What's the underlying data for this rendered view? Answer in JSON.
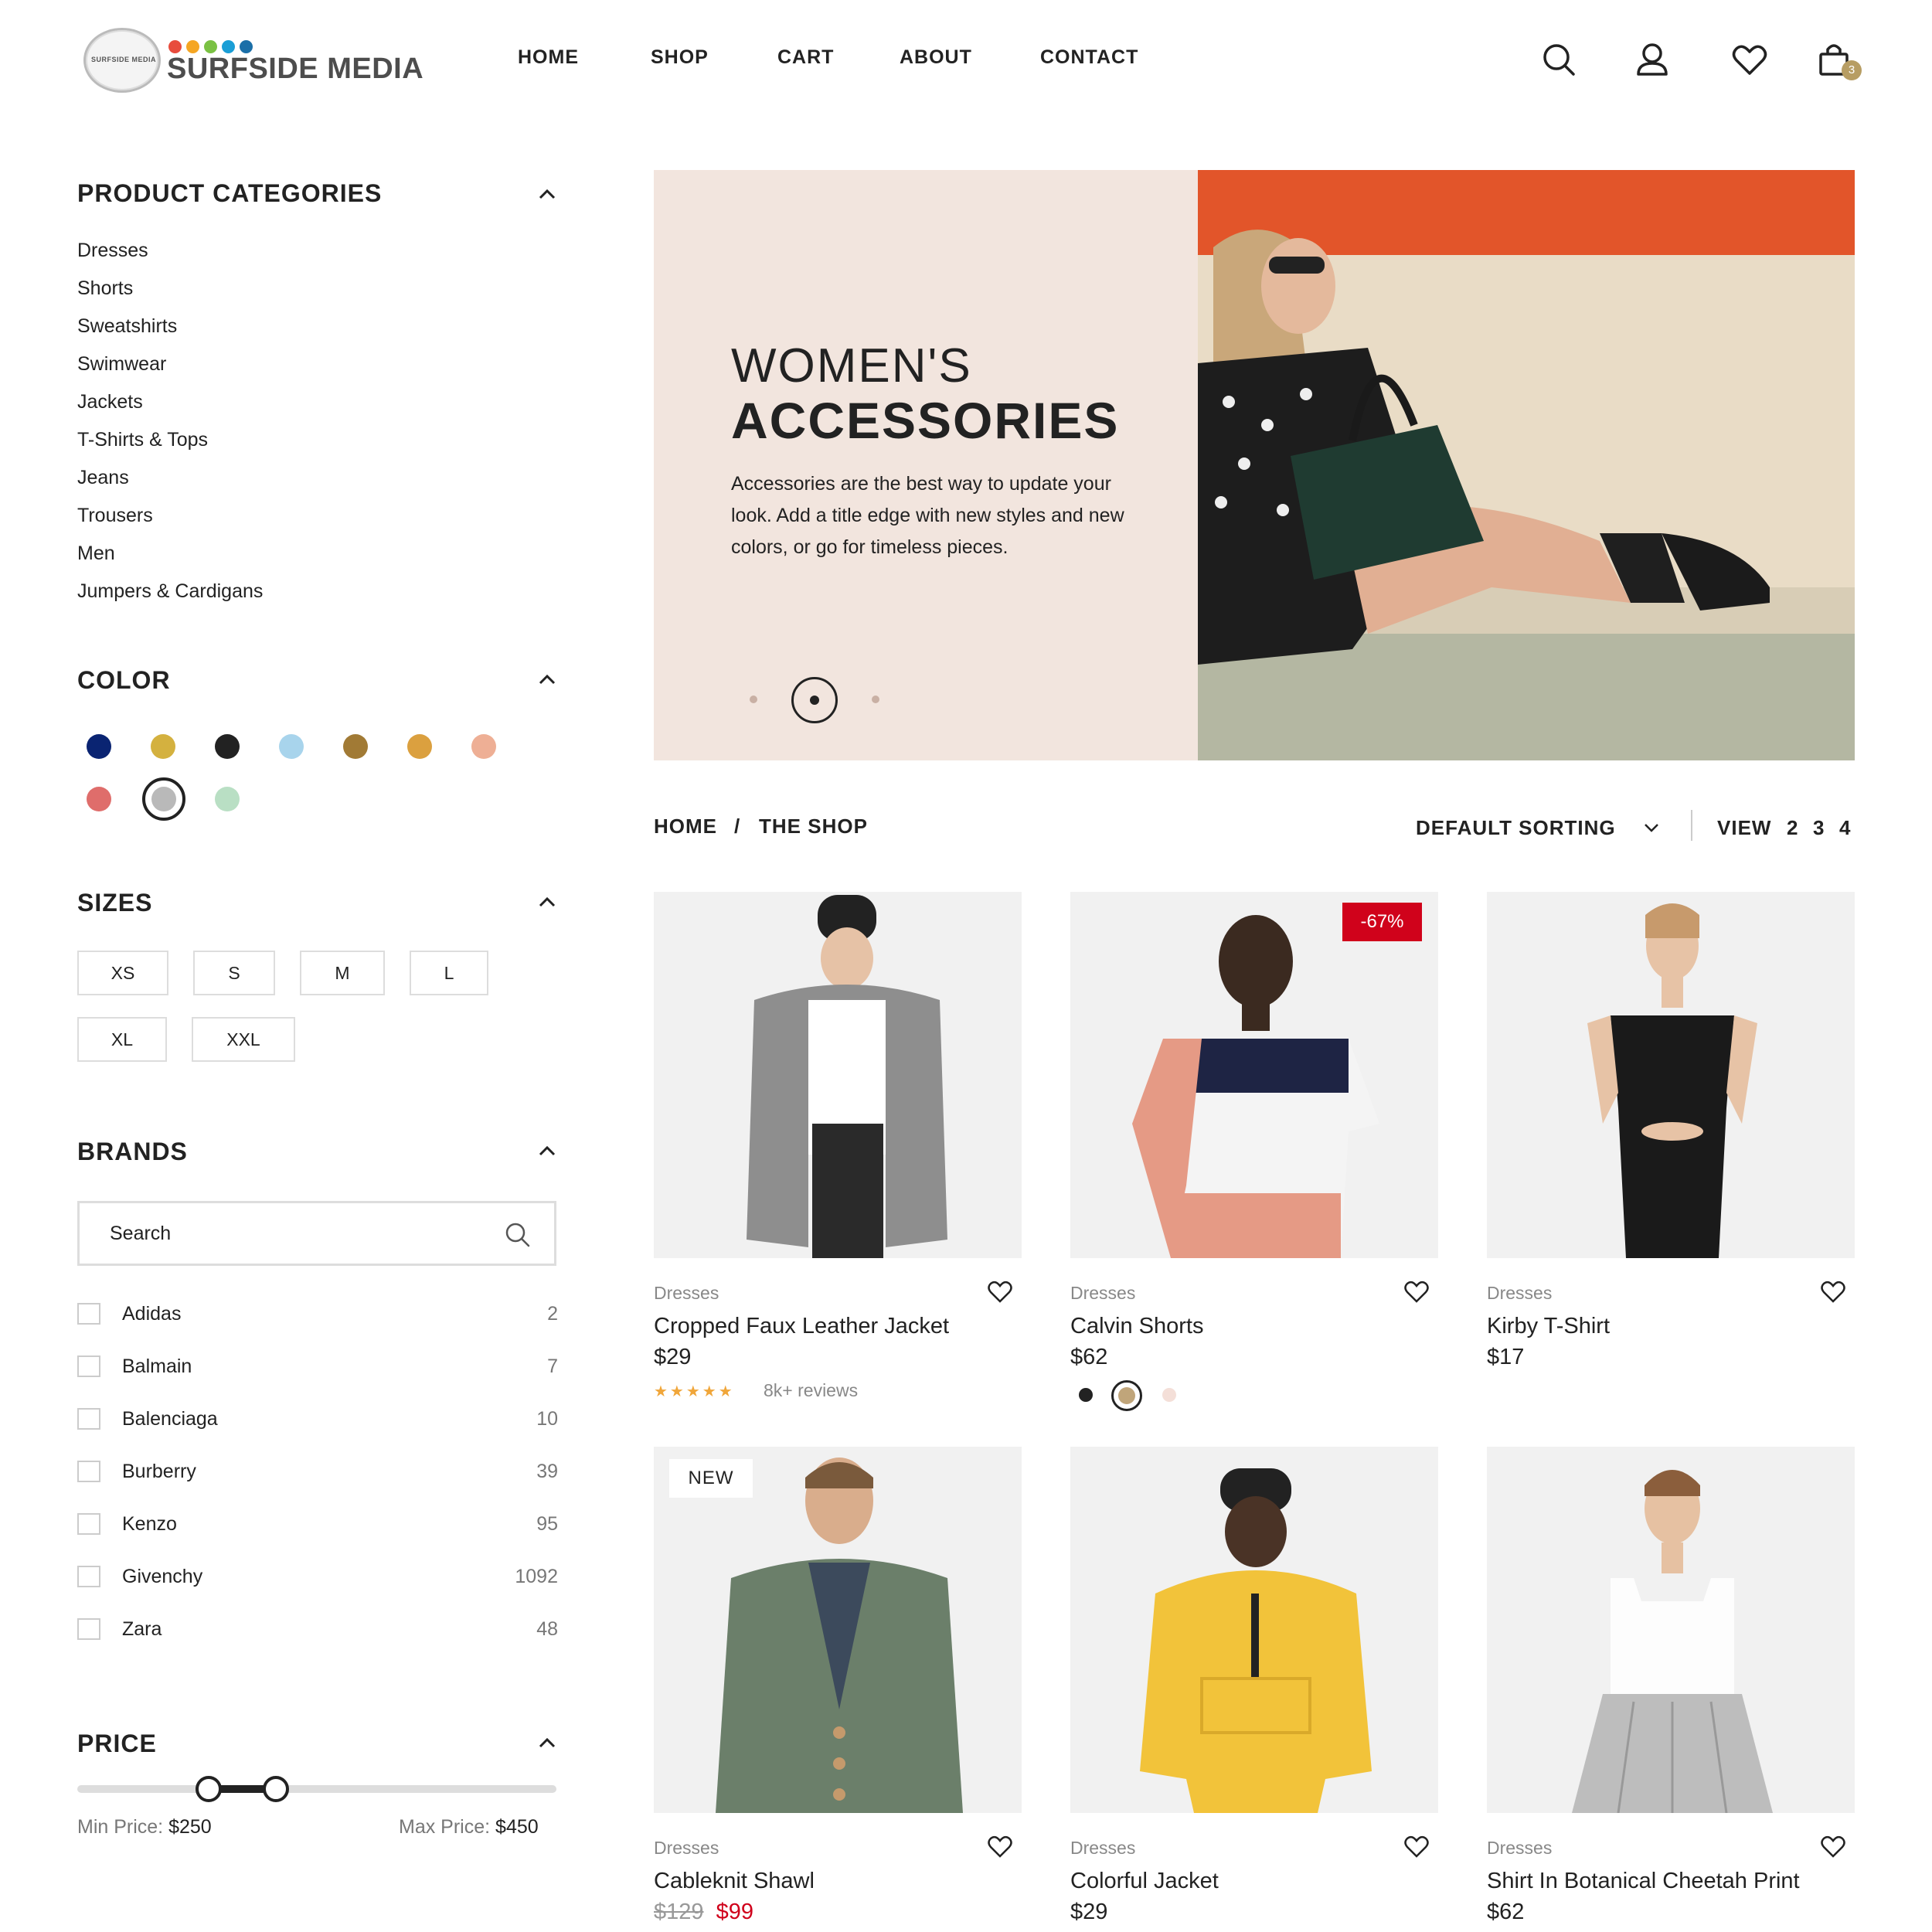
{
  "header": {
    "logo_text": "SURFSIDE MEDIA",
    "logo_mini_text": "SURFSIDE MEDIA",
    "logo_dot_colors": [
      "#e84c3d",
      "#f5a623",
      "#7ac143",
      "#1a9ed6",
      "#1b6fa8"
    ],
    "nav": [
      "HOME",
      "SHOP",
      "CART",
      "ABOUT",
      "CONTACT"
    ],
    "icons": [
      "search-icon",
      "user-icon",
      "heart-icon",
      "shopping-bag-icon"
    ],
    "cart_count": "3"
  },
  "sidebar": {
    "categories_title": "PRODUCT CATEGORIES",
    "categories": [
      "Dresses",
      "Shorts",
      "Sweatshirts",
      "Swimwear",
      "Jackets",
      "T-Shirts & Tops",
      "Jeans",
      "Trousers",
      "Men",
      "Jumpers & Cardigans"
    ],
    "color_title": "COLOR",
    "colors": [
      "#0a2472",
      "#d4b13f",
      "#222222",
      "#a8d4ec",
      "#a17a35",
      "#dba03f",
      "#eeaf95",
      "#df6d6b",
      "#b9b9b9",
      "#b9dfc4"
    ],
    "selected_color": "#b9b9b9",
    "sizes_title": "SIZES",
    "sizes": [
      "XS",
      "S",
      "M",
      "L",
      "XL",
      "XXL"
    ],
    "brands_title": "BRANDS",
    "brand_search_placeholder": "Search",
    "brands": [
      {
        "name": "Adidas",
        "count": "2"
      },
      {
        "name": "Balmain",
        "count": "7"
      },
      {
        "name": "Balenciaga",
        "count": "10"
      },
      {
        "name": "Burberry",
        "count": "39"
      },
      {
        "name": "Kenzo",
        "count": "95"
      },
      {
        "name": "Givenchy",
        "count": "1092"
      },
      {
        "name": "Zara",
        "count": "48"
      }
    ],
    "price_title": "PRICE",
    "min_price_label": "Min Price:",
    "min_price": "$250",
    "max_price_label": "Max Price:",
    "max_price": "$450"
  },
  "hero": {
    "title_line1": "WOMEN'S",
    "title_line2": "ACCESSORIES",
    "description": "Accessories are the best way to update your look. Add a title edge with new styles and new colors, or go for timeless pieces.",
    "active_slide": 2,
    "slide_count": 3
  },
  "breadcrumb": {
    "home": "HOME",
    "separator": "/",
    "current": "THE SHOP"
  },
  "toolbar": {
    "sorting": "DEFAULT SORTING",
    "view_label": "VIEW",
    "view_options": [
      "2",
      "3",
      "4"
    ]
  },
  "products": [
    {
      "category": "Dresses",
      "name": "Cropped Faux Leather Jacket",
      "price": "$29",
      "rating_stars": "★★★★★",
      "reviews": "8k+ reviews"
    },
    {
      "category": "Dresses",
      "name": "Calvin Shorts",
      "price": "$62",
      "badge": "-67%",
      "swatches": [
        "#222222",
        "#c0a57a",
        "#f4dfd8"
      ]
    },
    {
      "category": "Dresses",
      "name": "Kirby T-Shirt",
      "price": "$17"
    },
    {
      "category": "Dresses",
      "name": "Cableknit Shawl",
      "old_price": "$129",
      "price": "$99",
      "badge": "NEW"
    },
    {
      "category": "Dresses",
      "name": "Colorful Jacket",
      "price": "$29"
    },
    {
      "category": "Dresses",
      "name": "Shirt In Botanical Cheetah Print",
      "price": "$62"
    }
  ]
}
